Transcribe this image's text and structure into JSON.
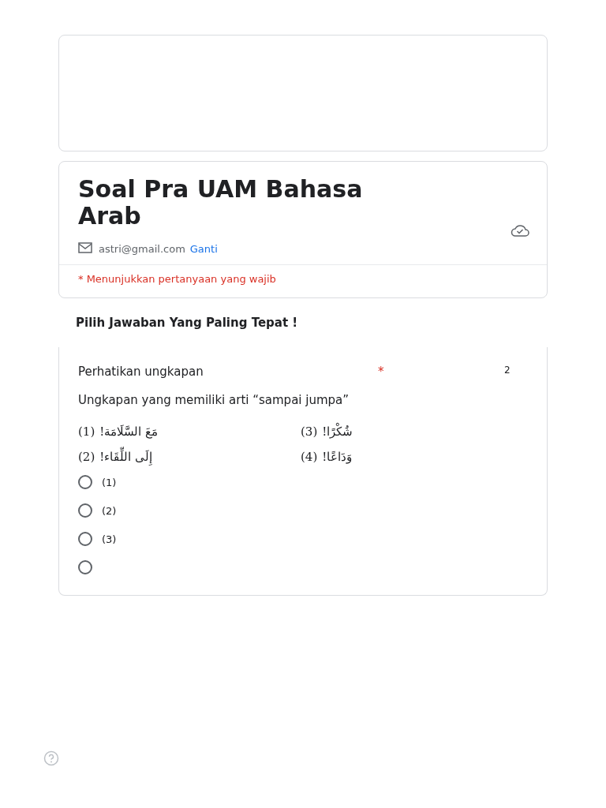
{
  "form": {
    "title": "Soal Pra UAM Bahasa Arab",
    "email": "astri@gmail.com",
    "switch_link": "Ganti",
    "required_note": "* Menunjukkan pertanyaan yang wajib"
  },
  "section_title": "Pilih Jawaban Yang Paling Tepat !",
  "question": {
    "title": "Perhatikan ungkapan",
    "required_mark": "*",
    "points": "2",
    "prompt": "Ungkapan yang memiliki arti “sampai jumpa”",
    "phrases_left_column": [
      {
        "number": "(1)",
        "arabic": "مَعَ السَّلَامَة!"
      },
      {
        "number": "(2)",
        "arabic": "إِلَى اللِّقَاء!"
      }
    ],
    "phrases_right_column": [
      {
        "number": "(3)",
        "arabic": "شُكْرًا!"
      },
      {
        "number": "(4)",
        "arabic": "وَدَاعًا!"
      }
    ],
    "options": [
      {
        "label": "(1)",
        "selected": false
      },
      {
        "label": "(2)",
        "selected": false
      },
      {
        "label": "(3)",
        "selected": false
      },
      {
        "selected": false
      }
    ]
  }
}
